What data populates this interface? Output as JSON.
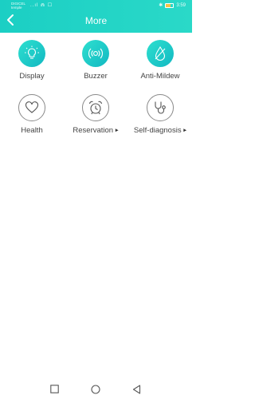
{
  "status_bar": {
    "carrier_line1": "DIGICEL",
    "carrier_line2": "temple",
    "indicators": "..ıl ⋒ ☐",
    "bluetooth": "✱",
    "battery_level": 0.6,
    "time": "3:59"
  },
  "header": {
    "back_icon": "chevron-left-icon",
    "title": "More"
  },
  "tiles": [
    {
      "label": "Display",
      "icon": "lightbulb-icon",
      "style": "filled",
      "has_arrow": false
    },
    {
      "label": "Buzzer",
      "icon": "buzzer-icon",
      "style": "filled",
      "has_arrow": false
    },
    {
      "label": "Anti-Mildew",
      "icon": "droplet-icon",
      "style": "filled",
      "has_arrow": false
    },
    {
      "label": "Health",
      "icon": "heart-icon",
      "style": "outline",
      "has_arrow": false
    },
    {
      "label": "Reservation",
      "icon": "alarm-clock-icon",
      "style": "outline",
      "has_arrow": true
    },
    {
      "label": "Self-diagnosis",
      "icon": "stethoscope-icon",
      "style": "outline",
      "has_arrow": true
    }
  ],
  "arrow_glyph": "▶",
  "colors": {
    "accent": "#1bcfc4",
    "icon_outline": "#8a8a8a",
    "label_text": "#444444"
  },
  "nav": {
    "recents_icon": "square-icon",
    "home_icon": "circle-icon",
    "back_icon": "triangle-back-icon"
  }
}
